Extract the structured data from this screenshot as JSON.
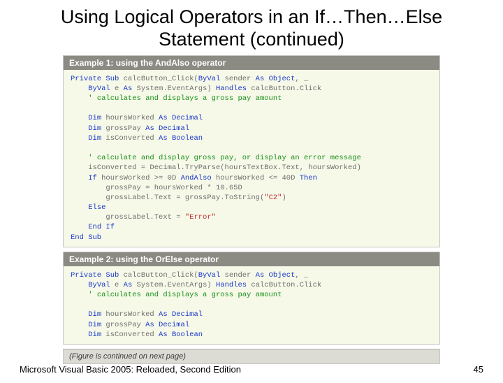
{
  "title": "Using Logical Operators in an If…Then…Else Statement (continued)",
  "example1": {
    "header": "Example 1: using the AndAlso operator",
    "line1_a": "Private Sub",
    "line1_b": " calcButton_Click(",
    "line1_c": "ByVal",
    "line1_d": " sender ",
    "line1_e": "As Object",
    "line1_f": ", _",
    "line2_a": "ByVal",
    "line2_b": " e ",
    "line2_c": "As",
    "line2_d": " System.EventArgs) ",
    "line2_e": "Handles",
    "line2_f": " calcButton.Click",
    "line3": "' calculates and displays a gross pay amount",
    "line4_a": "Dim",
    "line4_b": " hoursWorked ",
    "line4_c": "As Decimal",
    "line5_a": "Dim",
    "line5_b": " grossPay ",
    "line5_c": "As Decimal",
    "line6_a": "Dim",
    "line6_b": " isConverted ",
    "line6_c": "As Boolean",
    "line7": "' calculate and display gross pay, or display an error message",
    "line8": "isConverted = Decimal.TryParse(hoursTextBox.Text, hoursWorked)",
    "line9_a": "If",
    "line9_b": " hoursWorked >= 0D ",
    "line9_c": "AndAlso",
    "line9_d": " hoursWorked <= 40D ",
    "line9_e": "Then",
    "line10": "grossPay = hoursWorked * 10.65D",
    "line11_a": "grossLabel.Text = grossPay.ToString(",
    "line11_b": "\"C2\"",
    "line11_c": ")",
    "line12": "Else",
    "line13_a": "grossLabel.Text = ",
    "line13_b": "\"Error\"",
    "line14": "End If",
    "line15": "End Sub"
  },
  "example2": {
    "header": "Example 2: using the OrElse operator",
    "line1_a": "Private Sub",
    "line1_b": " calcButton_Click(",
    "line1_c": "ByVal",
    "line1_d": " sender ",
    "line1_e": "As Object",
    "line1_f": ", _",
    "line2_a": "ByVal",
    "line2_b": " e ",
    "line2_c": "As",
    "line2_d": " System.EventArgs) ",
    "line2_e": "Handles",
    "line2_f": " calcButton.Click",
    "line3": "' calculates and displays a gross pay amount",
    "line4_a": "Dim",
    "line4_b": " hoursWorked ",
    "line4_c": "As Decimal",
    "line5_a": "Dim",
    "line5_b": " grossPay ",
    "line5_c": "As Decimal",
    "line6_a": "Dim",
    "line6_b": " isConverted ",
    "line6_c": "As Boolean"
  },
  "continued_note": "(Figure is continued on next page)",
  "footer_left": "Microsoft Visual Basic 2005: Reloaded, Second Edition",
  "footer_right": "45"
}
